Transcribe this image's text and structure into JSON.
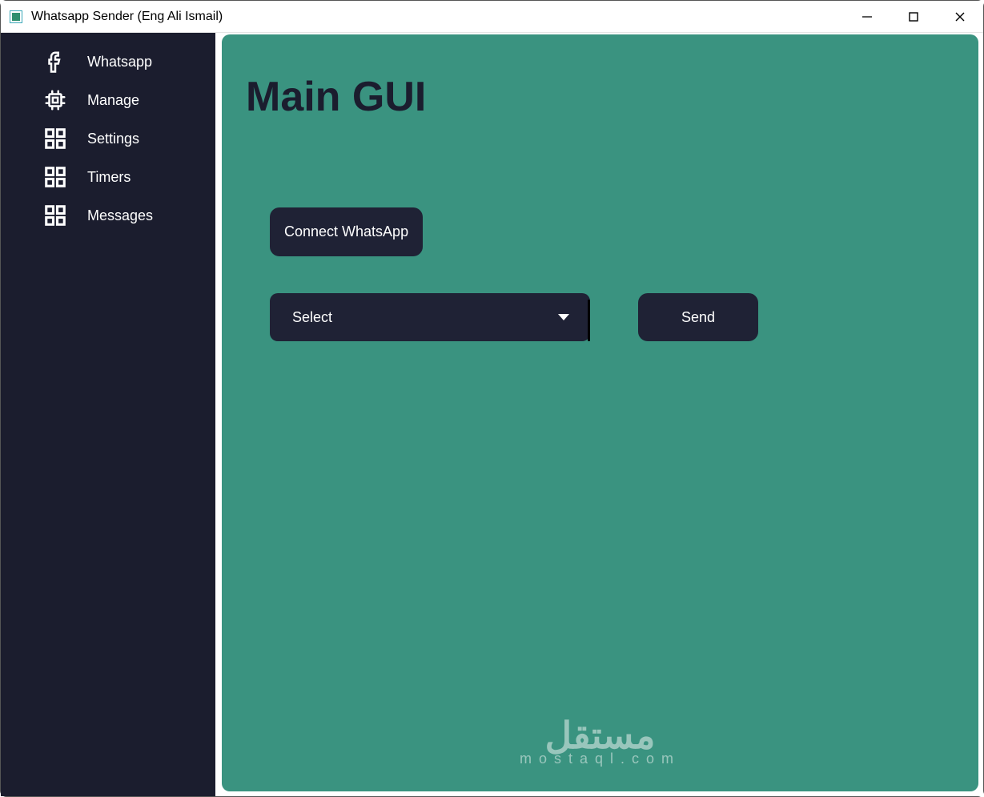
{
  "window": {
    "title": "Whatsapp Sender (Eng Ali Ismail)"
  },
  "sidebar": {
    "items": [
      {
        "label": "Whatsapp"
      },
      {
        "label": "Manage"
      },
      {
        "label": "Settings"
      },
      {
        "label": "Timers"
      },
      {
        "label": "Messages"
      }
    ]
  },
  "main": {
    "title": "Main GUI",
    "connect_label": "Connect WhatsApp",
    "select_value": "Select",
    "send_label": "Send"
  },
  "watermark": {
    "arabic": "مستقل",
    "latin": "mostaql.com"
  }
}
